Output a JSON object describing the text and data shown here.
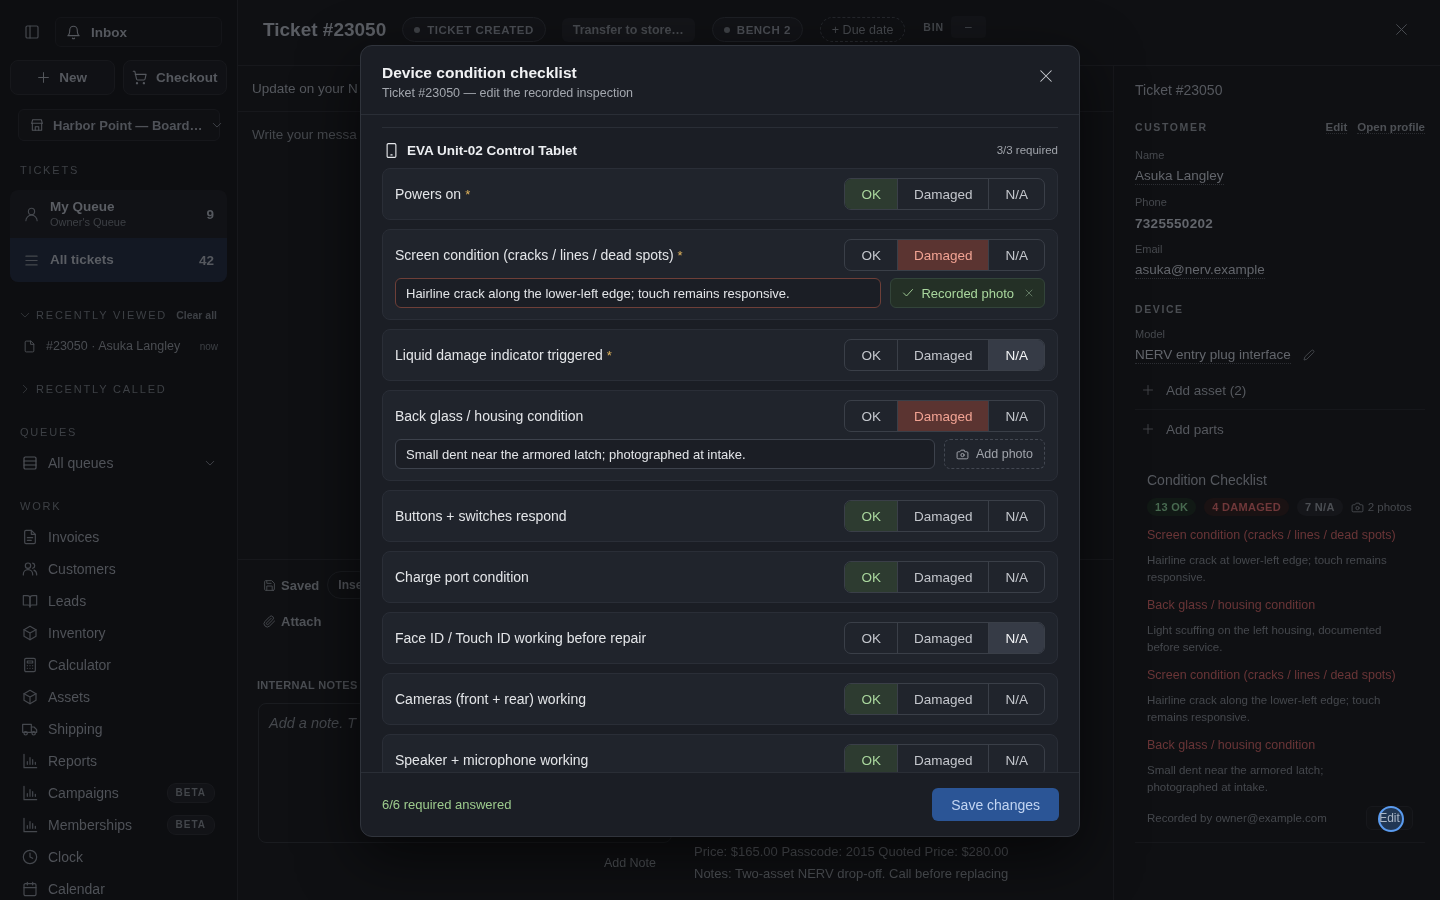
{
  "sidebar": {
    "inbox": "Inbox",
    "new_button": "New",
    "checkout_button": "Checkout",
    "location": "Harbor Point — Board…",
    "tickets_heading": "TICKETS",
    "ticket_queues": [
      {
        "kind": "person",
        "label": "My Queue",
        "sublabel": "Owner's Queue",
        "count": "9",
        "selected": false
      },
      {
        "kind": "list",
        "label": "All tickets",
        "count": "42",
        "selected": true
      }
    ],
    "recently_viewed": {
      "title": "RECENTLY VIEWED",
      "expanded": true,
      "action": "Clear all",
      "items": [
        {
          "label": "#23050 · Asuka Langley",
          "time": "now"
        }
      ]
    },
    "recently_called": {
      "title": "RECENTLY CALLED",
      "expanded": false
    },
    "queues_heading": "QUEUES",
    "queue_select": "All queues",
    "work_heading": "WORK",
    "work_items": [
      {
        "label": "Invoices"
      },
      {
        "label": "Customers"
      },
      {
        "label": "Leads"
      },
      {
        "label": "Inventory"
      },
      {
        "label": "Calculator"
      },
      {
        "label": "Assets"
      },
      {
        "label": "Shipping"
      },
      {
        "label": "Reports"
      },
      {
        "label": "Campaigns",
        "badge": "BETA"
      },
      {
        "label": "Memberships",
        "badge": "BETA"
      },
      {
        "label": "Clock"
      },
      {
        "label": "Calendar"
      }
    ]
  },
  "header": {
    "title": "Ticket #23050",
    "status": "TICKET CREATED",
    "transfer": "Transfer to store…",
    "bench": "BENCH 2",
    "due_date": "+ Due date",
    "bin_label": "BIN",
    "bin_value": "–"
  },
  "compose": {
    "subject": "Update on your N",
    "message_placeholder": "Write your messa",
    "saved": "Saved",
    "insert": "Inse",
    "attach": "Attach"
  },
  "internal_notes": {
    "heading": "INTERNAL NOTES",
    "placeholder": "Add a note. T",
    "add_button": "Add Note",
    "entry_lines": [
      "Price: $165.00 Passcode: 2015 Quoted Price: $280.00",
      "Notes: Two-asset NERV drop-off. Call before replacing"
    ]
  },
  "details": {
    "title": "Ticket #23050",
    "customer": {
      "heading": "CUSTOMER",
      "links": [
        "Edit",
        "Open profile"
      ],
      "fields": [
        {
          "label": "Name",
          "value": "Asuka Langley"
        },
        {
          "label": "Phone",
          "value": "7325550202"
        },
        {
          "label": "Email",
          "value": "asuka@nerv.example"
        }
      ]
    },
    "device": {
      "heading": "DEVICE",
      "fields": [
        {
          "label": "Model",
          "value": "NERV entry plug interface",
          "editable": true
        }
      ]
    },
    "actions": [
      "Add asset (2)",
      "Add parts"
    ],
    "checklist": {
      "title": "Condition Checklist",
      "counts": [
        {
          "kind": "ok",
          "label": "13 OK"
        },
        {
          "kind": "damaged",
          "label": "4 DAMAGED"
        },
        {
          "kind": "na",
          "label": "7 N/A"
        }
      ],
      "photos": "2 photos",
      "entries": [
        {
          "item": "Screen condition (cracks / lines / dead spots)",
          "note": "Hairline crack at lower-left edge; touch remains responsive."
        },
        {
          "item": "Back glass / housing condition",
          "note": "Light scuffing on the left housing, documented before service."
        },
        {
          "item": "Screen condition (cracks / lines / dead spots)",
          "note": "Hairline crack along the lower-left edge; touch remains responsive."
        },
        {
          "item": "Back glass / housing condition",
          "note": "Small dent near the armored latch; photographed at intake."
        }
      ],
      "recorded_by": "Recorded by owner@example.com",
      "edit_button": {
        "label": "Edit",
        "focused": true
      }
    }
  },
  "modal": {
    "title": "Device condition checklist",
    "subtitle": "Ticket #23050 — edit the recorded inspection",
    "device": {
      "name": "EVA Unit-02 Control Tablet",
      "required": "3/3 required"
    },
    "items": [
      {
        "label": "Powers on",
        "required_mark": "*",
        "options": [
          {
            "kind": "ok",
            "label": "OK",
            "selected": true
          },
          {
            "kind": "damaged",
            "label": "Damaged",
            "selected": false
          },
          {
            "kind": "na",
            "label": "N/A",
            "selected": false
          }
        ]
      },
      {
        "label": "Screen condition (cracks / lines / dead spots)",
        "required_mark": "*",
        "options": [
          {
            "kind": "ok",
            "label": "OK",
            "selected": false
          },
          {
            "kind": "damaged",
            "label": "Damaged",
            "selected": true
          },
          {
            "kind": "na",
            "label": "N/A",
            "selected": false
          }
        ],
        "note": {
          "value": "Hairline crack along the lower-left edge; touch remains responsive.",
          "focused": true
        },
        "photo": {
          "kind": "recorded",
          "label": "Recorded photo"
        }
      },
      {
        "label": "Liquid damage indicator triggered",
        "required_mark": "*",
        "options": [
          {
            "kind": "ok",
            "label": "OK",
            "selected": false
          },
          {
            "kind": "damaged",
            "label": "Damaged",
            "selected": false
          },
          {
            "kind": "na",
            "label": "N/A",
            "selected": true
          }
        ]
      },
      {
        "label": "Back glass / housing condition",
        "options": [
          {
            "kind": "ok",
            "label": "OK",
            "selected": false
          },
          {
            "kind": "damaged",
            "label": "Damaged",
            "selected": true
          },
          {
            "kind": "na",
            "label": "N/A",
            "selected": false
          }
        ],
        "note": {
          "value": "Small dent near the armored latch; photographed at intake.",
          "focused": false
        },
        "photo": {
          "kind": "add",
          "label": "Add photo"
        }
      },
      {
        "label": "Buttons + switches respond",
        "options": [
          {
            "kind": "ok",
            "label": "OK",
            "selected": true
          },
          {
            "kind": "damaged",
            "label": "Damaged",
            "selected": false
          },
          {
            "kind": "na",
            "label": "N/A",
            "selected": false
          }
        ]
      },
      {
        "label": "Charge port condition",
        "options": [
          {
            "kind": "ok",
            "label": "OK",
            "selected": true
          },
          {
            "kind": "damaged",
            "label": "Damaged",
            "selected": false
          },
          {
            "kind": "na",
            "label": "N/A",
            "selected": false
          }
        ]
      },
      {
        "label": "Face ID / Touch ID working before repair",
        "options": [
          {
            "kind": "ok",
            "label": "OK",
            "selected": false
          },
          {
            "kind": "damaged",
            "label": "Damaged",
            "selected": false
          },
          {
            "kind": "na",
            "label": "N/A",
            "selected": true
          }
        ]
      },
      {
        "label": "Cameras (front + rear) working",
        "options": [
          {
            "kind": "ok",
            "label": "OK",
            "selected": true
          },
          {
            "kind": "damaged",
            "label": "Damaged",
            "selected": false
          },
          {
            "kind": "na",
            "label": "N/A",
            "selected": false
          }
        ]
      },
      {
        "label": "Speaker + microphone working",
        "options": [
          {
            "kind": "ok",
            "label": "OK",
            "selected": true
          },
          {
            "kind": "damaged",
            "label": "Damaged",
            "selected": false
          },
          {
            "kind": "na",
            "label": "N/A",
            "selected": false
          }
        ]
      }
    ],
    "footer": {
      "status": "6/6 required answered",
      "save_button": "Save changes"
    }
  }
}
